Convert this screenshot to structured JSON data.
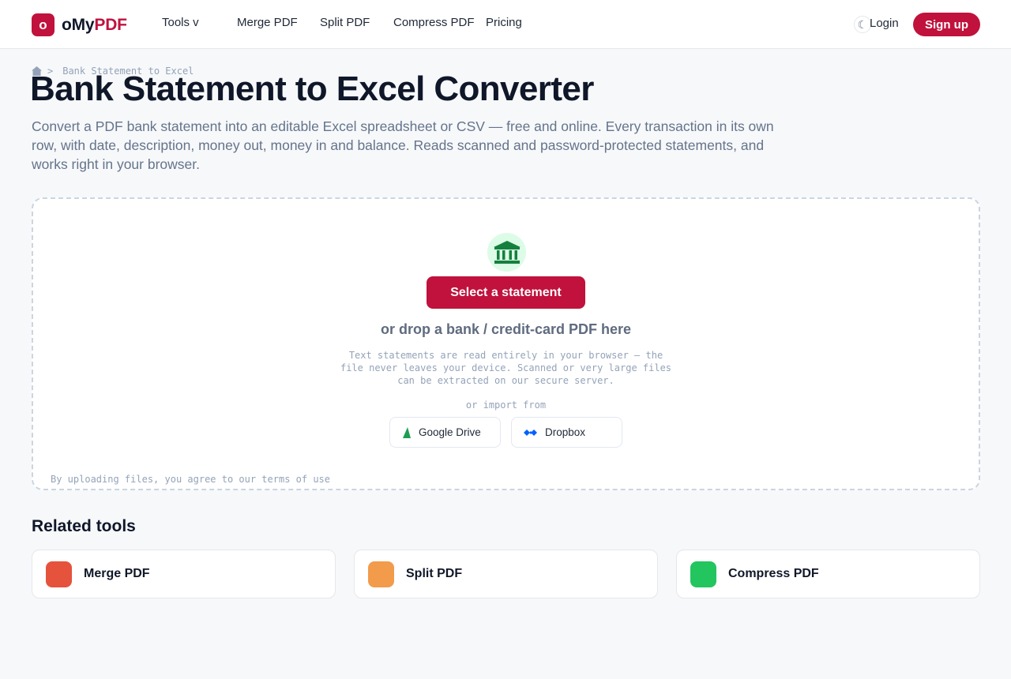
{
  "header": {
    "logo_mark": "o",
    "logo_text_main": "oMy",
    "logo_text_accent": "PDF",
    "nav": {
      "tools": "Tools  v",
      "merge": "Merge PDF",
      "split": "Split PDF",
      "compress": "Compress PDF",
      "pricing": "Pricing"
    },
    "theme_icon": "moon-icon",
    "login": "Login",
    "signup": "Sign up"
  },
  "breadcrumb": {
    "home_icon": "home-icon",
    "separator": ">",
    "current": "Bank Statement to Excel"
  },
  "page": {
    "title": "Bank Statement to Excel Converter",
    "description": "Convert a PDF bank statement into an editable Excel spreadsheet or CSV — free and online. Every transaction in its own row, with date, description, money out, money in and balance. Reads scanned and password-protected statements, and works right in your browser."
  },
  "dropzone": {
    "icon": "bank-icon",
    "select_button": "Select a statement",
    "drop_text": "or drop a bank / credit-card PDF here",
    "privacy_note": "Text statements are read entirely in your browser — the file never leaves your device. Scanned or very large files can be extracted on our secure server.",
    "import_label": "or import from",
    "import_options": [
      {
        "label": "Google Drive",
        "icon": "google-drive-icon"
      },
      {
        "label": "Dropbox",
        "icon": "dropbox-icon"
      }
    ],
    "terms": "By uploading files, you agree to our terms of use"
  },
  "related": {
    "title": "Related tools",
    "tools": [
      {
        "label": "Merge PDF",
        "color": "#e5533d"
      },
      {
        "label": "Split PDF",
        "color": "#f29b4b"
      },
      {
        "label": "Compress PDF",
        "color": "#22c55e"
      }
    ]
  },
  "colors": {
    "brand": "#c0123c",
    "bank_icon": "#15803d",
    "bank_icon_bg": "#dcfce7"
  }
}
